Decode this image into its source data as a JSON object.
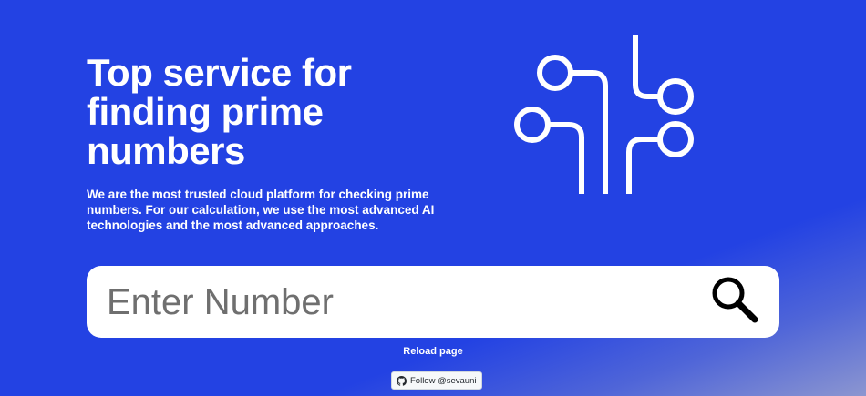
{
  "hero": {
    "title": "Top service for\nfinding prime\nnumbers",
    "description": "We are the most trusted cloud platform for checking prime numbers. For our calculation, we use the most advanced AI technologies and the most advanced approaches.",
    "illustration_icon": "circuit-icon"
  },
  "search": {
    "placeholder": "Enter Number",
    "value": "",
    "button_icon": "search-icon"
  },
  "footer": {
    "reload_label": "Reload page",
    "follow_label": "Follow @sevauni",
    "follow_icon": "github-icon"
  },
  "colors": {
    "background": "#2342e3",
    "text": "#ffffff",
    "search_bg": "#ffffff",
    "placeholder": "#6f6f6f"
  }
}
